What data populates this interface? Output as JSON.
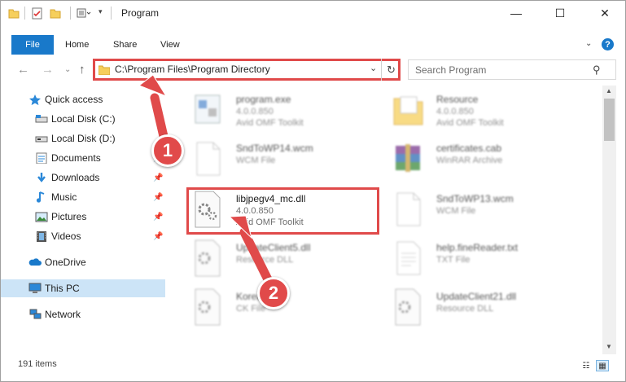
{
  "window": {
    "title": "Program",
    "controls": {
      "minimize": "—",
      "maximize": "☐",
      "close": "✕"
    }
  },
  "ribbon": {
    "tabs": [
      "File",
      "Home",
      "Share",
      "View"
    ],
    "chevron": "⌄",
    "help": "?"
  },
  "nav": {
    "back": "←",
    "forward": "→",
    "recent": "⌄",
    "up": "↑",
    "address": "C:\\Program Files\\Program Directory",
    "address_dropdown": "⌄",
    "refresh": "↻",
    "search_placeholder": "Search Program",
    "search_icon": "⚲"
  },
  "sidebar": {
    "items": [
      {
        "label": "Quick access",
        "icon": "star-icon",
        "pinned": false
      },
      {
        "label": "Local Disk (C:)",
        "icon": "drive-icon",
        "pinned": false
      },
      {
        "label": "Local Disk (D:)",
        "icon": "drive-icon",
        "pinned": false
      },
      {
        "label": "Documents",
        "icon": "documents-icon",
        "pinned": true
      },
      {
        "label": "Downloads",
        "icon": "download-icon",
        "pinned": true
      },
      {
        "label": "Music",
        "icon": "music-icon",
        "pinned": true
      },
      {
        "label": "Pictures",
        "icon": "pictures-icon",
        "pinned": true
      },
      {
        "label": "Videos",
        "icon": "videos-icon",
        "pinned": true
      },
      {
        "label": "OneDrive",
        "icon": "cloud-icon",
        "pinned": false
      },
      {
        "label": "This PC",
        "icon": "pc-icon",
        "pinned": false,
        "selected": true
      },
      {
        "label": "Network",
        "icon": "network-icon",
        "pinned": false
      }
    ],
    "pin_glyph": "📌"
  },
  "files": [
    {
      "name": "program.exe",
      "line2": "4.0.0.850",
      "line3": "Avid OMF Toolkit",
      "icon": "exe-icon"
    },
    {
      "name": "Resource",
      "line2": "4.0.0.850",
      "line3": "Avid OMF Toolkit",
      "icon": "folder-icon"
    },
    {
      "name": "SndToWP14.wcm",
      "line2": "WCM File",
      "line3": "",
      "icon": "blank-file-icon"
    },
    {
      "name": "certificates.cab",
      "line2": "WinRAR Archive",
      "line3": "",
      "icon": "winrar-icon"
    },
    {
      "name": "libjpegv4_mc.dll",
      "line2": "4.0.0.850",
      "line3": "Avid OMF Toolkit",
      "icon": "dll-gear-icon"
    },
    {
      "name": "SndToWP13.wcm",
      "line2": "WCM File",
      "line3": "",
      "icon": "blank-file-icon"
    },
    {
      "name": "UpdateClient5.dll",
      "line2": "Resource DLL",
      "line3": "",
      "icon": "dll-gear-icon"
    },
    {
      "name": "help.fineReader.txt",
      "line2": "TXT File",
      "line3": "",
      "icon": "text-file-icon"
    },
    {
      "name": "Korea",
      "line2": "CK File",
      "line3": "",
      "icon": "dll-gear-icon"
    },
    {
      "name": "UpdateClient21.dll",
      "line2": "Resource DLL",
      "line3": "",
      "icon": "dll-gear-icon"
    }
  ],
  "status": {
    "count": "191 items"
  },
  "annotations": {
    "marker1": "1",
    "marker2": "2"
  },
  "colors": {
    "accent": "#1979ca",
    "highlight": "#e04a4a",
    "selected": "#cce4f7"
  }
}
